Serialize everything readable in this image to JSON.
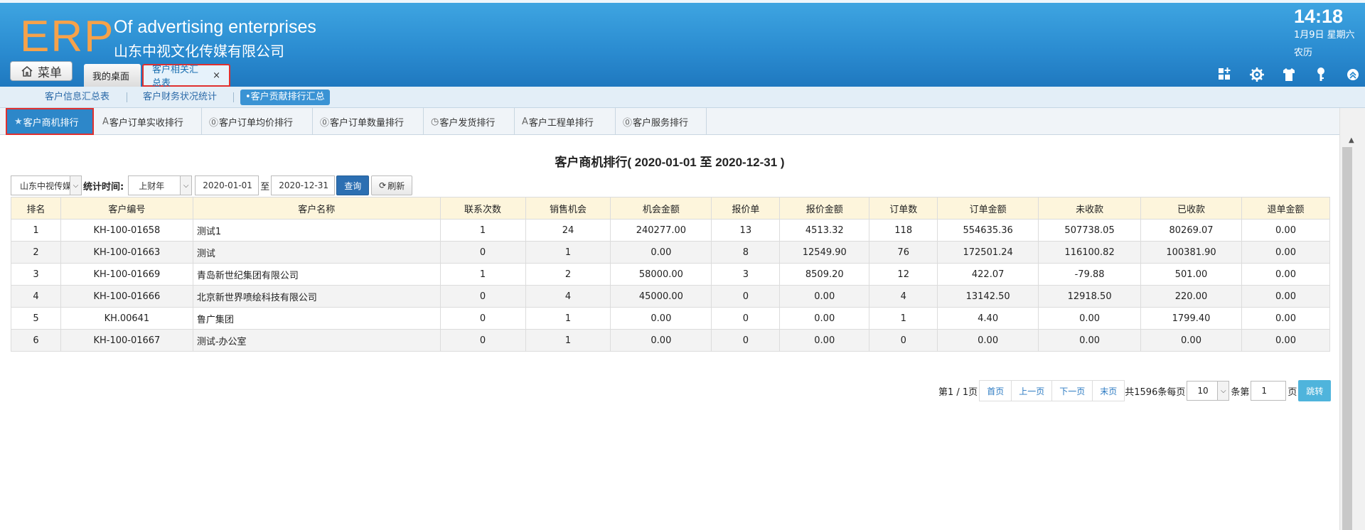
{
  "header": {
    "logo": "ERP",
    "company_en": "Of advertising enterprises",
    "company_cn": "山东中视文化传媒有限公司",
    "time": "14:18",
    "date": "1月9日 星期六",
    "lunar": "农历"
  },
  "menu_button_label": "菜单",
  "main_tabs": [
    {
      "label": "我的桌面"
    },
    {
      "label": "客户相关汇总表",
      "close": "×"
    }
  ],
  "toolbar_icons": [
    "grid-add-icon",
    "gear-icon",
    "shirt-icon",
    "key-icon",
    "collapse-icon"
  ],
  "subnav": [
    {
      "label": "客户信息汇总表"
    },
    {
      "label": "客户财务状况统计"
    },
    {
      "label": "•客户贡献排行汇总"
    }
  ],
  "report_tabs": [
    {
      "label": "客户商机排行",
      "icon": "★"
    },
    {
      "label": "客户订单实收排行",
      "icon": "A"
    },
    {
      "label": "客户订单均价排行",
      "icon": "⓪"
    },
    {
      "label": "客户订单数量排行",
      "icon": "⓪"
    },
    {
      "label": "客户发货排行",
      "icon": "◷"
    },
    {
      "label": "客户工程单排行",
      "icon": "A"
    },
    {
      "label": "客户服务排行",
      "icon": "⓪"
    }
  ],
  "report": {
    "title": "客户商机排行( 2020-01-01 至 2020-12-31 )"
  },
  "filters": {
    "company": "山东中视传媒",
    "period_label": "统计时间:",
    "period": "上财年",
    "start_date": "2020-01-01",
    "to": "至",
    "end_date": "2020-12-31",
    "query_label": "查询",
    "refresh_label": "刷新"
  },
  "table": {
    "headers": [
      "排名",
      "客户编号",
      "客户名称",
      "联系次数",
      "销售机会",
      "机会金额",
      "报价单",
      "报价金额",
      "订单数",
      "订单金额",
      "未收款",
      "已收款",
      "退单金额"
    ],
    "rows": [
      [
        "1",
        "KH-100-01658",
        "测试1",
        "1",
        "24",
        "240277.00",
        "13",
        "4513.32",
        "118",
        "554635.36",
        "507738.05",
        "80269.07",
        "0.00"
      ],
      [
        "2",
        "KH-100-01663",
        "测试",
        "0",
        "1",
        "0.00",
        "8",
        "12549.90",
        "76",
        "172501.24",
        "116100.82",
        "100381.90",
        "0.00"
      ],
      [
        "3",
        "KH-100-01669",
        "青岛新世纪集团有限公司",
        "1",
        "2",
        "58000.00",
        "3",
        "8509.20",
        "12",
        "422.07",
        "-79.88",
        "501.00",
        "0.00"
      ],
      [
        "4",
        "KH-100-01666",
        "北京新世界喷绘科技有限公司",
        "0",
        "4",
        "45000.00",
        "0",
        "0.00",
        "4",
        "13142.50",
        "12918.50",
        "220.00",
        "0.00"
      ],
      [
        "5",
        "KH.00641",
        "鲁广集团",
        "0",
        "1",
        "0.00",
        "0",
        "0.00",
        "1",
        "4.40",
        "0.00",
        "1799.40",
        "0.00"
      ],
      [
        "6",
        "KH-100-01667",
        "测试-办公室",
        "0",
        "1",
        "0.00",
        "0",
        "0.00",
        "0",
        "0.00",
        "0.00",
        "0.00",
        "0.00"
      ]
    ]
  },
  "pager": {
    "page_info": "第1 / 1页",
    "first": "首页",
    "prev": "上一页",
    "next": "下一页",
    "last": "末页",
    "total": "共1596条每页",
    "page_size": "10",
    "per_page_suffix": "条第",
    "page_number": "1",
    "page_suffix": "页",
    "jump": "跳转"
  },
  "colors": {
    "header_blue": "#2a8bd0",
    "logo_orange": "#f6a24a",
    "active_tab": "#2d87c9",
    "highlight_red": "#e0302f"
  }
}
